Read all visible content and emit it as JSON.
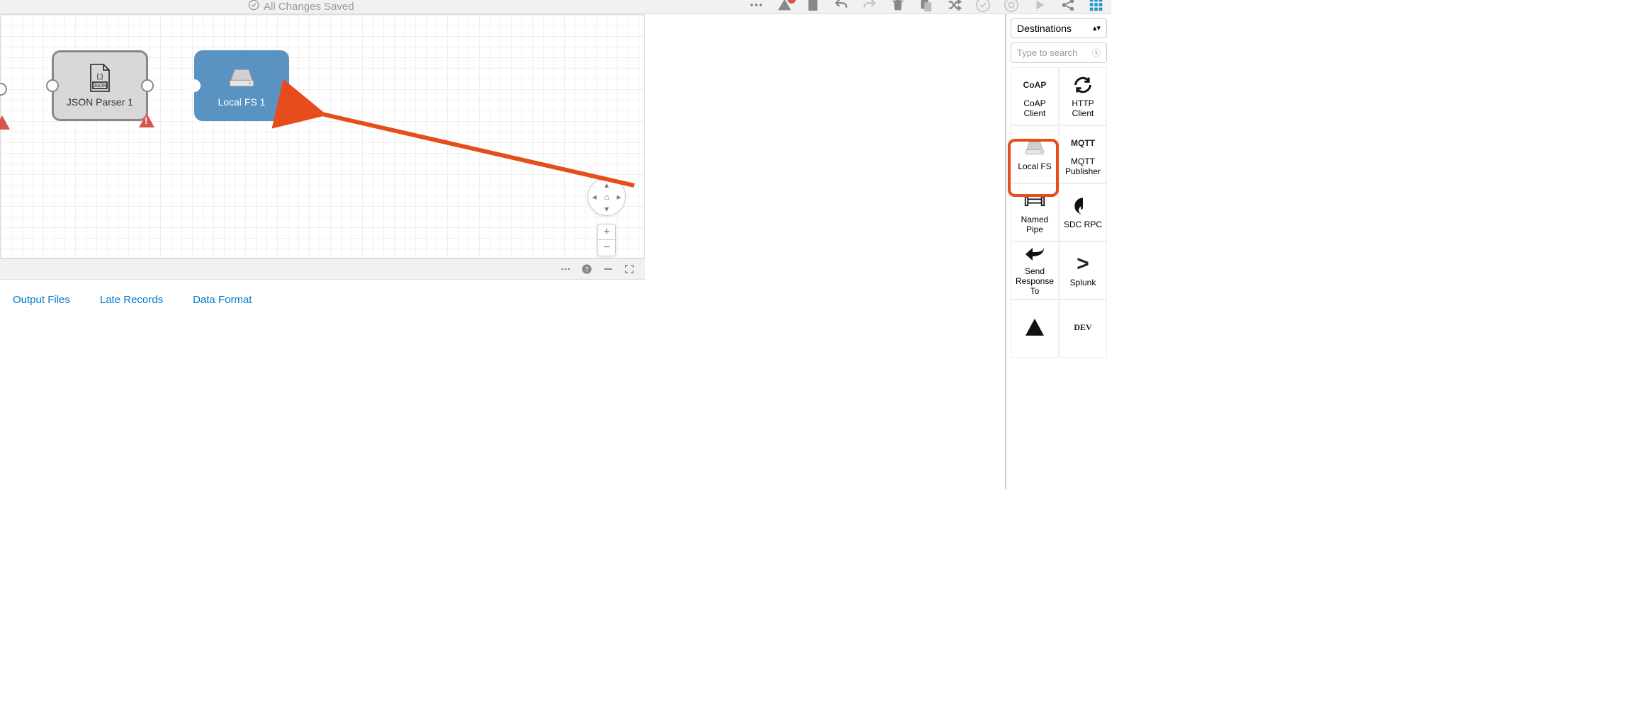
{
  "toolbar": {
    "status_text": "All Changes Saved"
  },
  "canvas": {
    "nodes": {
      "json_parser": {
        "label": "JSON Parser 1"
      },
      "local_fs": {
        "label": "Local FS 1"
      }
    }
  },
  "tabs": {
    "output_files": "Output Files",
    "late_records": "Late Records",
    "data_format": "Data Format"
  },
  "sidebar": {
    "dropdown_label": "Destinations",
    "search_placeholder": "Type to search",
    "palette": [
      {
        "label": "CoAP Client",
        "icon_text": "CoAP"
      },
      {
        "label": "HTTP Client",
        "icon_text": ""
      },
      {
        "label": "Local FS",
        "icon_text": ""
      },
      {
        "label": "MQTT Publisher",
        "icon_text": "MQTT"
      },
      {
        "label": "Named Pipe",
        "icon_text": ""
      },
      {
        "label": "SDC RPC",
        "icon_text": ""
      },
      {
        "label": "Send Response To",
        "icon_text": ""
      },
      {
        "label": "Splunk",
        "icon_text": ">"
      },
      {
        "label": "",
        "icon_text": ""
      },
      {
        "label": "",
        "icon_text": "DEV"
      }
    ]
  },
  "colors": {
    "accent_orange": "#e74c1c",
    "node_blue": "#5a93c2",
    "node_gray": "#d8d8d8",
    "link": "#0077cc"
  }
}
